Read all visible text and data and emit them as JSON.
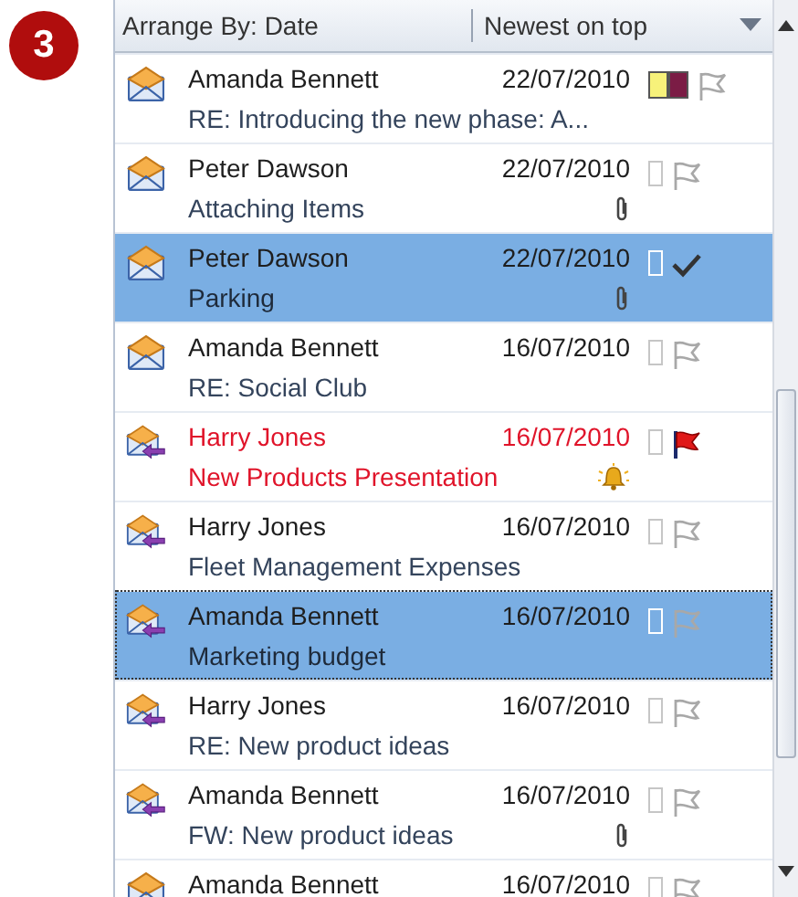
{
  "step_badge": "3",
  "header": {
    "arrange_by": "Arrange By: Date",
    "order": "Newest on top"
  },
  "rows": [
    {
      "kind": "received",
      "sender": "Amanda Bennett",
      "date": "22/07/2010",
      "subject": "RE: Introducing the new phase: A...",
      "selected": false,
      "focused": false,
      "overdue": false,
      "attachment": false,
      "reminder": false,
      "categories": [
        {
          "color": "#f7f27a"
        },
        {
          "color": "#7b1c45"
        }
      ],
      "flag": {
        "kind": "none"
      }
    },
    {
      "kind": "received",
      "sender": "Peter Dawson",
      "date": "22/07/2010",
      "subject": "Attaching Items",
      "selected": false,
      "focused": false,
      "overdue": false,
      "attachment": true,
      "reminder": false,
      "categories": [],
      "flag": {
        "kind": "none"
      }
    },
    {
      "kind": "received",
      "sender": "Peter Dawson",
      "date": "22/07/2010",
      "subject": "Parking",
      "selected": true,
      "focused": false,
      "overdue": false,
      "attachment": true,
      "reminder": false,
      "categories": [],
      "flag": {
        "kind": "complete"
      }
    },
    {
      "kind": "received",
      "sender": "Amanda Bennett",
      "date": "16/07/2010",
      "subject": "RE: Social Club",
      "selected": false,
      "focused": false,
      "overdue": false,
      "attachment": false,
      "reminder": false,
      "categories": [],
      "flag": {
        "kind": "none"
      }
    },
    {
      "kind": "replied",
      "sender": "Harry Jones",
      "date": "16/07/2010",
      "subject": "New Products Presentation",
      "selected": false,
      "focused": false,
      "overdue": true,
      "attachment": false,
      "reminder": true,
      "categories": [],
      "flag": {
        "kind": "flagged"
      }
    },
    {
      "kind": "replied",
      "sender": "Harry Jones",
      "date": "16/07/2010",
      "subject": "Fleet Management Expenses",
      "selected": false,
      "focused": false,
      "overdue": false,
      "attachment": false,
      "reminder": false,
      "categories": [],
      "flag": {
        "kind": "none"
      }
    },
    {
      "kind": "replied",
      "sender": "Amanda Bennett",
      "date": "16/07/2010",
      "subject": "Marketing budget",
      "selected": true,
      "focused": true,
      "overdue": false,
      "attachment": false,
      "reminder": false,
      "categories": [],
      "flag": {
        "kind": "none"
      }
    },
    {
      "kind": "replied",
      "sender": "Harry Jones",
      "date": "16/07/2010",
      "subject": "RE: New product ideas",
      "selected": false,
      "focused": false,
      "overdue": false,
      "attachment": false,
      "reminder": false,
      "categories": [],
      "flag": {
        "kind": "none"
      }
    },
    {
      "kind": "replied",
      "sender": "Amanda Bennett",
      "date": "16/07/2010",
      "subject": "FW: New product ideas",
      "selected": false,
      "focused": false,
      "overdue": false,
      "attachment": true,
      "reminder": false,
      "categories": [],
      "flag": {
        "kind": "none"
      }
    },
    {
      "kind": "received",
      "sender": "Amanda Bennett",
      "date": "16/07/2010",
      "selected": false,
      "focused": false,
      "overdue": false,
      "attachment": false,
      "reminder": false,
      "categories": [],
      "flag": {
        "kind": "none"
      }
    }
  ]
}
